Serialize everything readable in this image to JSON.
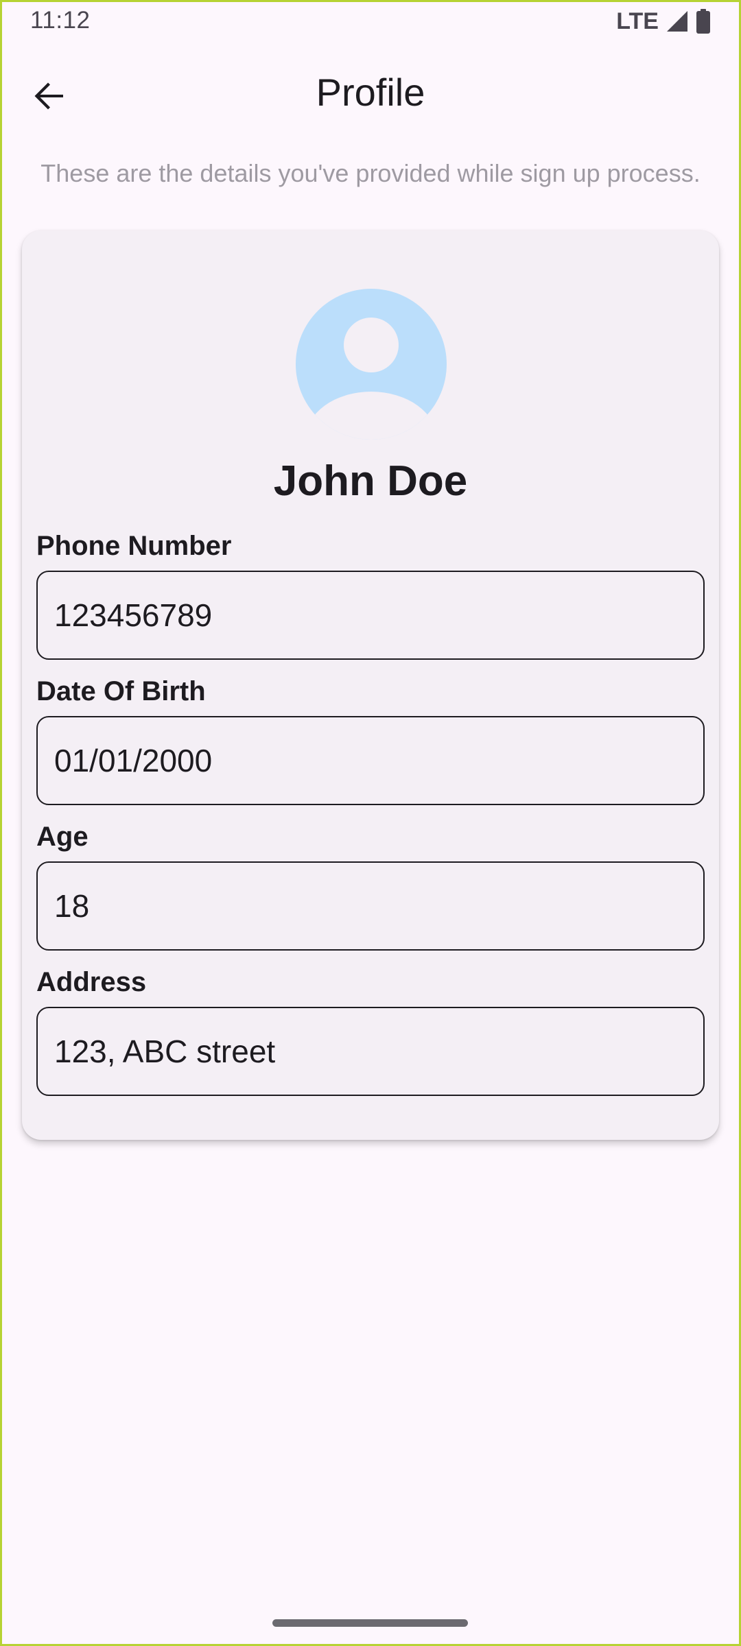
{
  "status_bar": {
    "time": "11:12",
    "network": "LTE"
  },
  "app_bar": {
    "title": "Profile",
    "back_icon": "arrow-back-icon"
  },
  "subtitle": "These are the details you've provided while sign up process.",
  "profile": {
    "avatar_icon": "account-circle-icon",
    "avatar_color": "#bbdefb",
    "name": "John Doe",
    "fields": [
      {
        "label": "Phone Number",
        "value": "123456789"
      },
      {
        "label": "Date Of Birth",
        "value": "01/01/2000"
      },
      {
        "label": "Age",
        "value": "18"
      },
      {
        "label": "Address",
        "value": "123, ABC street"
      }
    ]
  }
}
